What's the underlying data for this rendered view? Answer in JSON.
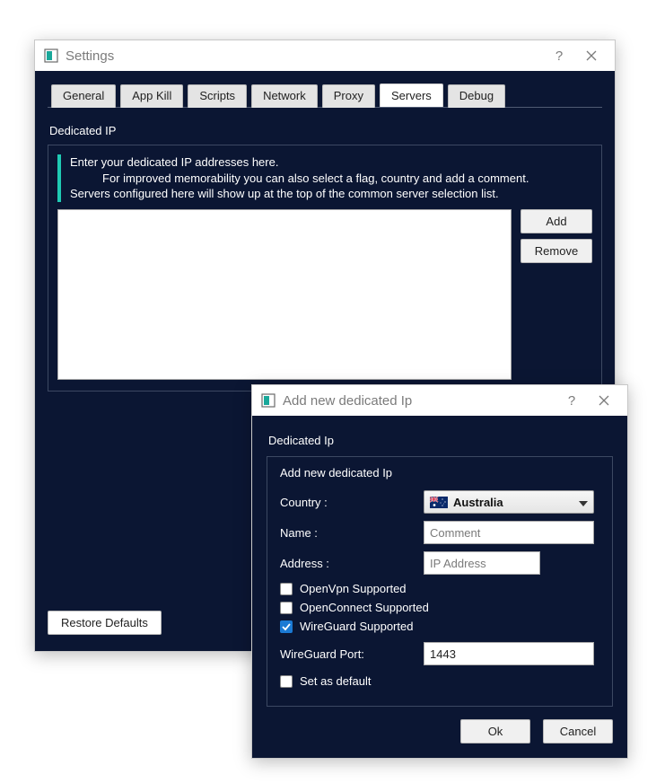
{
  "settings": {
    "title": "Settings",
    "tabs": [
      "General",
      "App Kill",
      "Scripts",
      "Network",
      "Proxy",
      "Servers",
      "Debug"
    ],
    "active_tab_index": 5,
    "dedicated_ip": {
      "section_label": "Dedicated IP",
      "hint_line1": "Enter your dedicated IP addresses here.",
      "hint_line2": "For improved memorability you can also select a flag, country and add a comment.",
      "hint_line3": "Servers configured here will show up at the top of the common server selection list.",
      "add_label": "Add",
      "remove_label": "Remove"
    },
    "restore_defaults_label": "Restore Defaults"
  },
  "dialog": {
    "title": "Add new dedicated Ip",
    "section_label": "Dedicated Ip",
    "legend": "Add new dedicated Ip",
    "country": {
      "label": "Country :",
      "selected": "Australia"
    },
    "name": {
      "label": "Name :",
      "placeholder": "Comment",
      "value": ""
    },
    "address": {
      "label": "Address :",
      "placeholder": "IP Address",
      "value": ""
    },
    "checks": {
      "openvpn": {
        "label": "OpenVpn Supported",
        "checked": false
      },
      "openconnect": {
        "label": "OpenConnect Supported",
        "checked": false
      },
      "wireguard": {
        "label": "WireGuard Supported",
        "checked": true
      }
    },
    "wireguard_port": {
      "label": "WireGuard Port:",
      "value": "1443"
    },
    "set_default": {
      "label": "Set as default",
      "checked": false
    },
    "ok_label": "Ok",
    "cancel_label": "Cancel"
  }
}
